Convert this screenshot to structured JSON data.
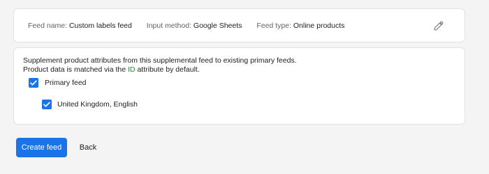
{
  "feed_info": {
    "name_label": "Feed name:",
    "name_value": "Custom labels feed",
    "method_label": "Input method:",
    "method_value": "Google Sheets",
    "type_label": "Feed type:",
    "type_value": "Online products",
    "edit_icon": "pencil-icon"
  },
  "supplement": {
    "line1": "Supplement product attributes from this supplemental feed to existing primary feeds.",
    "line2_prefix": "Product data is matched via the",
    "line2_link": "ID",
    "line2_suffix": "attribute by default.",
    "primary_feed": {
      "label": "Primary feed",
      "checked": true
    },
    "countries": [
      {
        "label": "United Kingdom, English",
        "checked": true
      }
    ]
  },
  "actions": {
    "create_label": "Create feed",
    "back_label": "Back"
  },
  "colors": {
    "accent": "#1a73e8",
    "link": "#1e8e3e",
    "background": "#f4f4f4"
  }
}
